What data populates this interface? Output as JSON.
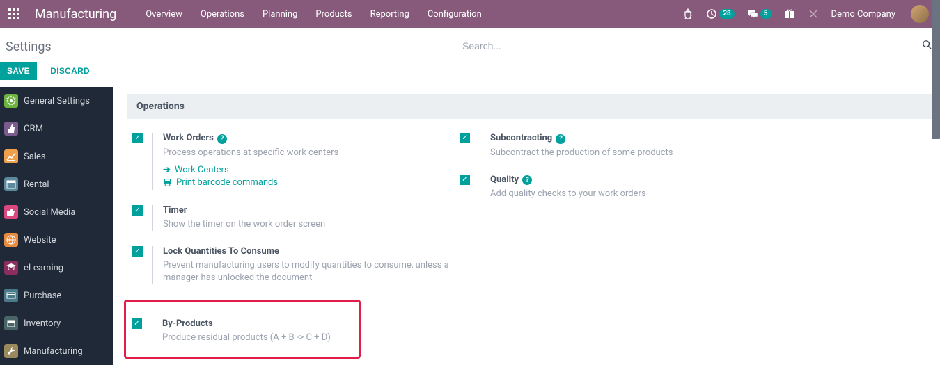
{
  "topbar": {
    "brand": "Manufacturing",
    "nav": [
      "Overview",
      "Operations",
      "Planning",
      "Products",
      "Reporting",
      "Configuration"
    ],
    "clock_badge": "28",
    "chat_badge": "5",
    "company": "Demo Company"
  },
  "page": {
    "title": "Settings",
    "search_placeholder": "Search...",
    "save": "SAVE",
    "discard": "DISCARD"
  },
  "sidebar": [
    {
      "label": "General Settings",
      "color": "#6cb33f",
      "icon": "gear"
    },
    {
      "label": "CRM",
      "color": "#7b5a8e",
      "icon": "hand"
    },
    {
      "label": "Sales",
      "color": "#f0a04b",
      "icon": "chart"
    },
    {
      "label": "Rental",
      "color": "#5b8a9c",
      "icon": "cal"
    },
    {
      "label": "Social Media",
      "color": "#d9487e",
      "icon": "thumb"
    },
    {
      "label": "Website",
      "color": "#e88b3e",
      "icon": "globe"
    },
    {
      "label": "eLearning",
      "color": "#8b2e5f",
      "icon": "grad"
    },
    {
      "label": "Purchase",
      "color": "#4a7a8a",
      "icon": "card"
    },
    {
      "label": "Inventory",
      "color": "#4a6568",
      "icon": "box"
    },
    {
      "label": "Manufacturing",
      "color": "#9a8a5c",
      "icon": "wrench"
    }
  ],
  "section": {
    "title": "Operations"
  },
  "settings": {
    "left": [
      {
        "title": "Work Orders",
        "help": true,
        "desc": "Process operations at specific work centers",
        "links": [
          {
            "icon": "arrow",
            "text": "Work Centers"
          },
          {
            "icon": "print",
            "text": "Print barcode commands"
          }
        ]
      },
      {
        "title": "Timer",
        "help": false,
        "desc": "Show the timer on the work order screen"
      },
      {
        "title": "Lock Quantities To Consume",
        "help": false,
        "desc": "Prevent manufacturing users to modify quantities to consume, unless a manager has unlocked the document"
      },
      {
        "title": "By-Products",
        "help": false,
        "desc": "Produce residual products (A + B -> C + D)",
        "highlighted": true
      }
    ],
    "right": [
      {
        "title": "Subcontracting",
        "help": true,
        "desc": "Subcontract the production of some products"
      },
      {
        "title": "Quality",
        "help": true,
        "desc": "Add quality checks to your work orders"
      }
    ]
  }
}
